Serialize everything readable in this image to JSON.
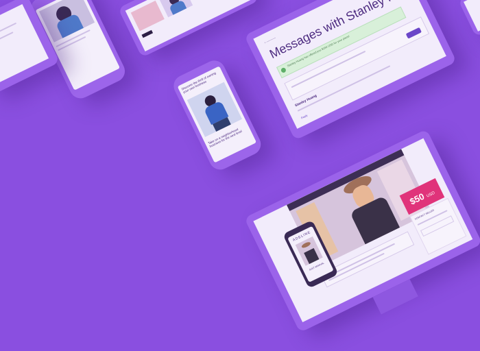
{
  "messages_page": {
    "title": "Messages with Stanley Huang",
    "notice": "Stanley Huang has offered you $150 USD for your piece!",
    "message_author": "Stanley Huang",
    "reply_label": "Reply"
  },
  "store_page": {
    "price_value": "$50",
    "price_currency": "USD",
    "brand": "ADELINE",
    "tagline": "JUST ARRIVAL",
    "contact_label": "CONTACT SELLER"
  },
  "phone_page": {
    "headline_top": "Discover the thrill of owning your own business",
    "headline_bottom": "Take on a neighborhood business for the next level"
  },
  "colors": {
    "background": "#8a4fe0",
    "accent_pink": "#e0337a",
    "button_purple": "#6b46c8"
  }
}
